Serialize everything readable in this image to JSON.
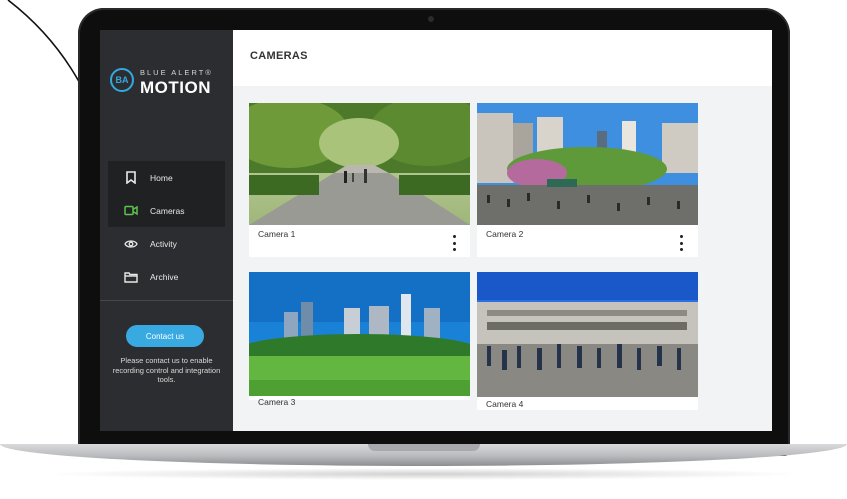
{
  "brand": {
    "mark": "BA",
    "name_top": "BLUE ALERT®",
    "name_bottom": "MOTION",
    "accent": "#39a9e1"
  },
  "sidebar": {
    "items": [
      {
        "label": "Home",
        "icon": "bookmark-icon"
      },
      {
        "label": "Cameras",
        "icon": "video-camera-icon",
        "active": true,
        "active_color": "#5cc34a"
      },
      {
        "label": "Activity",
        "icon": "eye-icon"
      },
      {
        "label": "Archive",
        "icon": "folder-icon"
      }
    ],
    "contact_button": "Contact us",
    "contact_text": "Please contact us to enable recording control and integration tools."
  },
  "header": {
    "title": "CAMERAS"
  },
  "cameras": [
    {
      "label": "Camera 1",
      "menu_icon": "more-vertical-icon"
    },
    {
      "label": "Camera 2",
      "menu_icon": "more-vertical-icon"
    },
    {
      "label": "Camera 3"
    },
    {
      "label": "Camera 4"
    }
  ]
}
